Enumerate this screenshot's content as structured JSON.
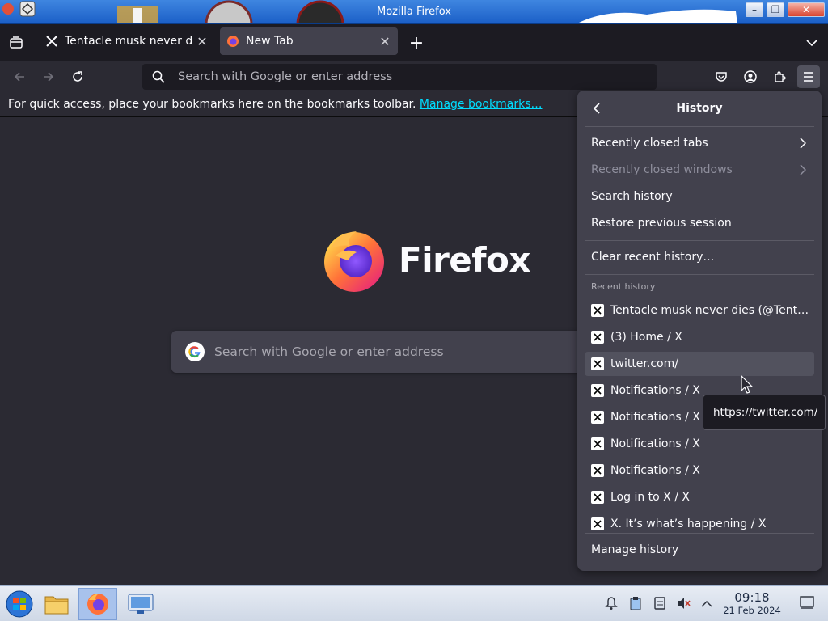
{
  "window": {
    "title": "Mozilla Firefox",
    "minimize_label": "–",
    "maximize_label": "❐",
    "close_label": "✕"
  },
  "tabs": [
    {
      "label": "Tentacle musk never dies (@Tentaclemusk) / X",
      "favicon": "x-logo-icon",
      "active": false,
      "close": "✕"
    },
    {
      "label": "New Tab",
      "favicon": "firefox-icon",
      "active": true,
      "close": "✕"
    }
  ],
  "tabstrip": {
    "new_tab": "+",
    "list_all": "⌄"
  },
  "urlbar": {
    "placeholder": "Search with Google or enter address"
  },
  "bookmarks_bar": {
    "text": "For quick access, place your bookmarks here on the bookmarks toolbar.",
    "link": "Manage bookmarks…"
  },
  "newtab": {
    "wordmark": "Firefox",
    "search_placeholder": "Search with Google or enter address"
  },
  "history_panel": {
    "title": "History",
    "menu": [
      {
        "label": "Recently closed tabs",
        "submenu": true,
        "disabled": false
      },
      {
        "label": "Recently closed windows",
        "submenu": true,
        "disabled": true
      },
      {
        "label": "Search history",
        "submenu": false,
        "disabled": false
      },
      {
        "label": "Restore previous session",
        "submenu": false,
        "disabled": false
      }
    ],
    "clear": "Clear recent history…",
    "recent_label": "Recent history",
    "recent": [
      "Tentacle musk never dies (@Tentaclemusk) / X",
      "(3) Home / X",
      "twitter.com/",
      "Notifications / X",
      "Notifications / X",
      "Notifications / X",
      "Notifications / X",
      "Log in to X / X",
      "X. It’s what’s happening / X"
    ],
    "hovered_index": 2,
    "manage": "Manage history"
  },
  "tooltip": {
    "text": "https://twitter.com/"
  },
  "taskbar": {
    "clock_time": "09:18",
    "clock_date": "21 Feb 2024"
  },
  "colors": {
    "accent_link": "#00ddff",
    "panel_bg": "#42414d",
    "toolbar_bg": "#2b2a33",
    "frame_bg": "#1c1b22"
  }
}
